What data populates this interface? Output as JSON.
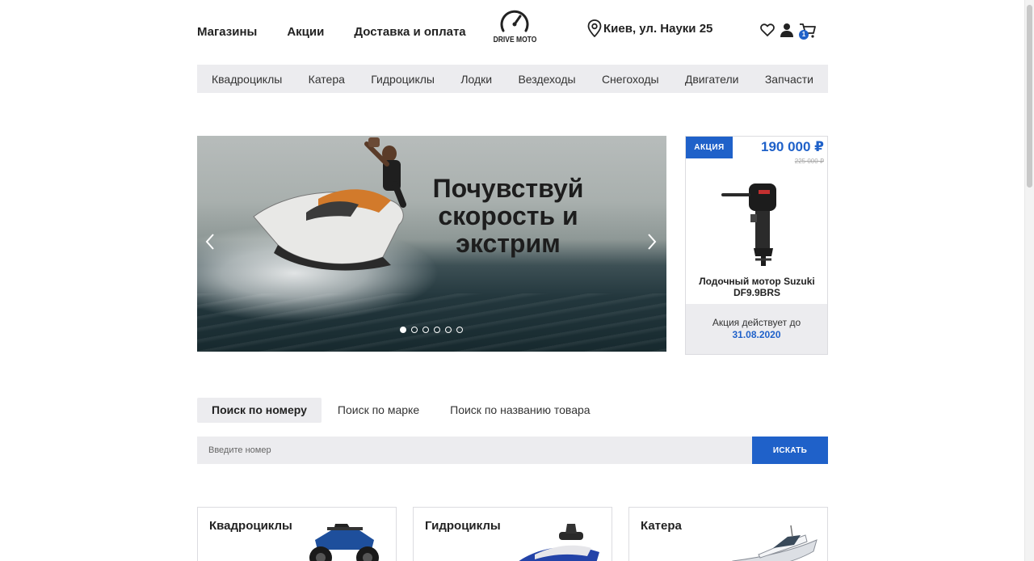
{
  "header": {
    "nav": [
      "Магазины",
      "Акции",
      "Доставка и оплата"
    ],
    "logo_text": "DRIVE MOTO",
    "location": "Киев, ул. Науки 25",
    "cart_count": "1"
  },
  "categories": [
    "Квадроциклы",
    "Катера",
    "Гидроциклы",
    "Лодки",
    "Вездеходы",
    "Снегоходы",
    "Двигатели",
    "Запчасти"
  ],
  "hero": {
    "title_line1": "Почувствуй",
    "title_line2": "скорость и",
    "title_line3": "экстрим",
    "slide_count": 6,
    "active_slide": 1
  },
  "promo": {
    "badge": "АКЦИЯ",
    "price": "190 000 ₽",
    "old_price": "225 000 ₽",
    "name": "Лодочный мотор Suzuki DF9.9BRS",
    "valid_label": "Акция действует до",
    "valid_date": "31.08.2020"
  },
  "search": {
    "tabs": [
      "Поиск по номеру",
      "Поиск по марке",
      "Поиск по названию товара"
    ],
    "active_tab": 0,
    "placeholder": "Введите номер",
    "button": "ИСКАТЬ"
  },
  "cards": [
    "Квадроциклы",
    "Гидроциклы",
    "Катера"
  ],
  "colors": {
    "accent": "#1f61c9",
    "panel": "#ececef"
  }
}
